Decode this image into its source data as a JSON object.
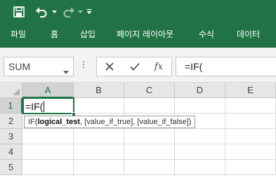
{
  "quick_access": {
    "save_icon": "save-icon",
    "undo_icon": "undo-icon",
    "redo_icon": "redo-icon",
    "customize_icon": "customize-dropdown-icon"
  },
  "ribbon": {
    "tabs": [
      "파일",
      "홈",
      "삽입",
      "페이지 레이아웃",
      "수식",
      "데이터"
    ],
    "bg_color": "#217346"
  },
  "formula_bar": {
    "name_box": "SUM",
    "fx_label": "fx",
    "formula": "=IF("
  },
  "sheet": {
    "columns": [
      "A",
      "B",
      "C",
      "D",
      "E"
    ],
    "rows": [
      "1",
      "2",
      "3",
      "4",
      "5"
    ],
    "selected_column": "A",
    "selected_row": "1",
    "active_cell_value": "=IF("
  },
  "tooltip": {
    "function_name": "IF(",
    "current_arg": "logical_test",
    "rest": ", [value_if_true], [value_if_false])"
  },
  "accent_color": "#217346"
}
